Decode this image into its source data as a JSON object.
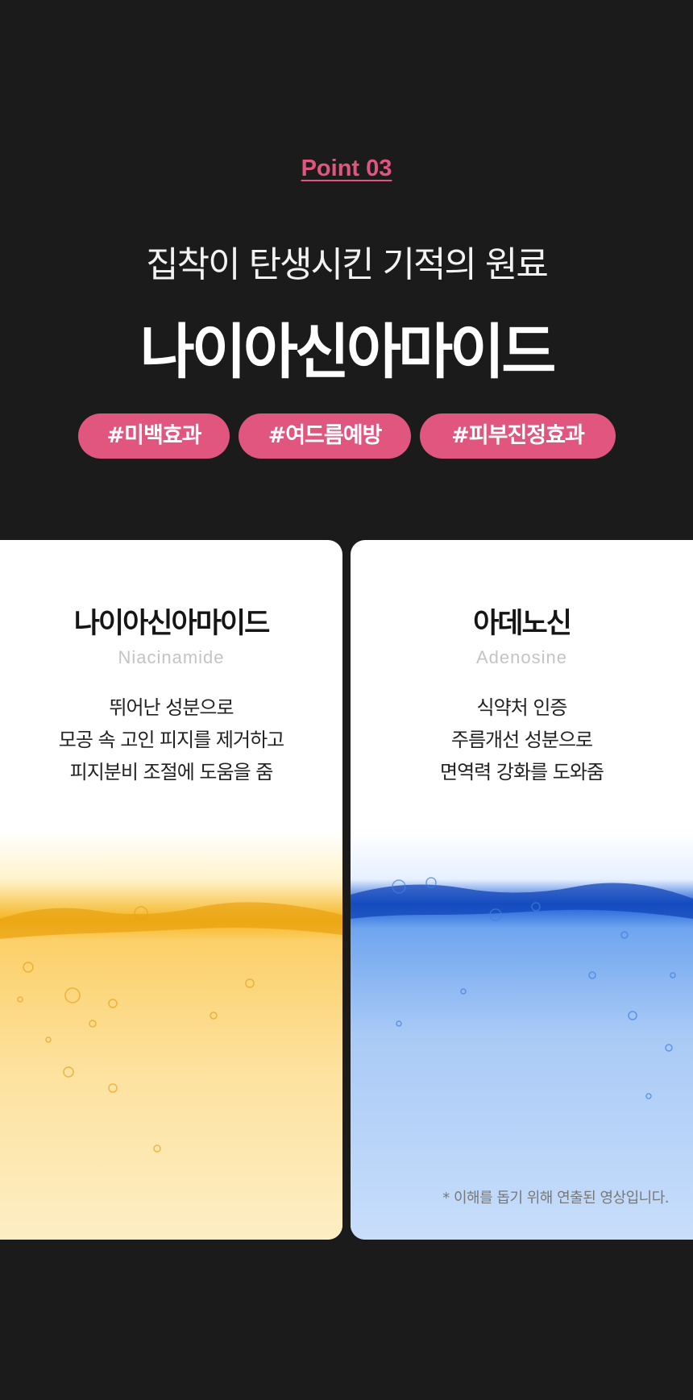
{
  "header": {
    "point_label": "Point 03",
    "subtitle": "집착이 탄생시킨 기적의 원료",
    "title": "나이아신아마이드"
  },
  "tags": [
    "#미백효과",
    "#여드름예방",
    "#피부진정효과"
  ],
  "colors": {
    "accent": "#e0567f",
    "background": "#1b1b1b",
    "card": "#ffffff"
  },
  "cards": [
    {
      "title": "나이아신아마이드",
      "english": "Niacinamide",
      "description": [
        "뛰어난 성분으로",
        "모공 속 고인 피지를 제거하고",
        "피지분비 조절에 도움을 줌"
      ],
      "image": "yellow-water-bubbles"
    },
    {
      "title": "아데노신",
      "english": "Adenosine",
      "description": [
        "식약처 인증",
        "주름개선 성분으로",
        "면역력 강화를 도와줌"
      ],
      "image": "blue-water-bubbles",
      "note": "* 이해를 돕기 위해 연출된 영상입니다."
    }
  ]
}
